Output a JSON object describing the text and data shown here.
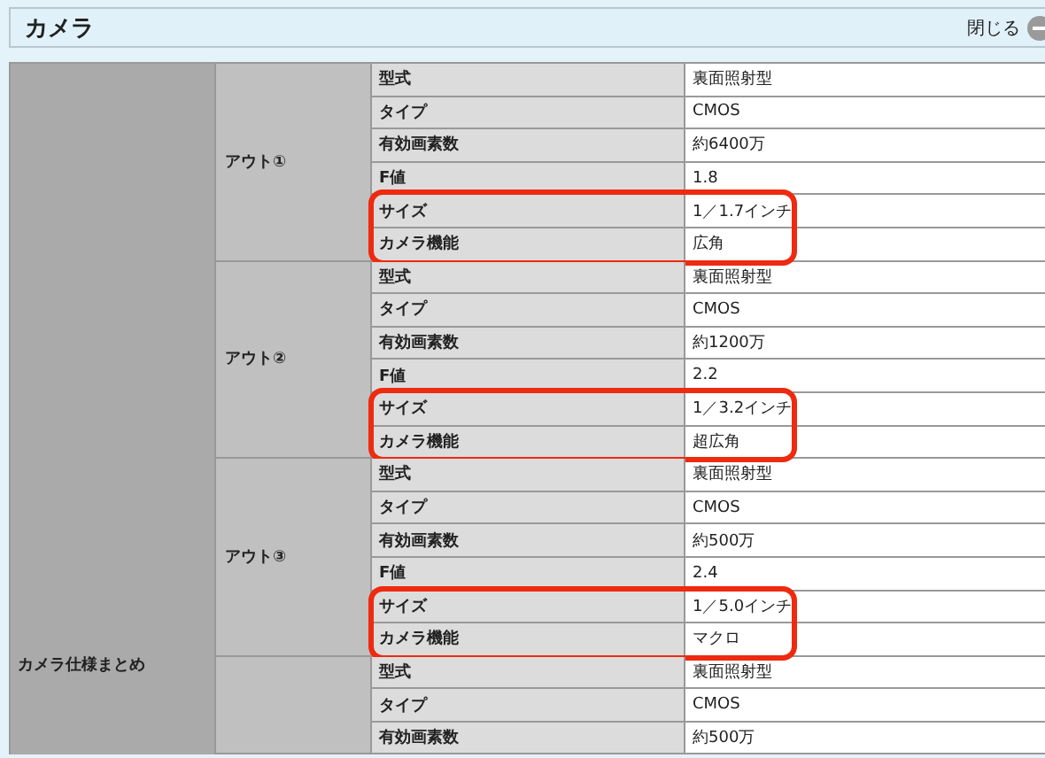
{
  "panel": {
    "title": "カメラ",
    "close_label": "閉じる"
  },
  "summary_label": "カメラ仕様まとめ",
  "groups": [
    {
      "label": "アウト①",
      "rows": [
        {
          "name": "型式",
          "value": "裏面照射型",
          "highlighted": false
        },
        {
          "name": "タイプ",
          "value": "CMOS",
          "highlighted": false
        },
        {
          "name": "有効画素数",
          "value": "約6400万",
          "highlighted": false
        },
        {
          "name": "F値",
          "value": "1.8",
          "highlighted": false
        },
        {
          "name": "サイズ",
          "value": "1／1.7インチ",
          "highlighted": true
        },
        {
          "name": "カメラ機能",
          "value": "広角",
          "highlighted": true
        }
      ]
    },
    {
      "label": "アウト②",
      "rows": [
        {
          "name": "型式",
          "value": "裏面照射型",
          "highlighted": false
        },
        {
          "name": "タイプ",
          "value": "CMOS",
          "highlighted": false
        },
        {
          "name": "有効画素数",
          "value": "約1200万",
          "highlighted": false
        },
        {
          "name": "F値",
          "value": "2.2",
          "highlighted": false
        },
        {
          "name": "サイズ",
          "value": "1／3.2インチ",
          "highlighted": true
        },
        {
          "name": "カメラ機能",
          "value": "超広角",
          "highlighted": true
        }
      ]
    },
    {
      "label": "アウト③",
      "rows": [
        {
          "name": "型式",
          "value": "裏面照射型",
          "highlighted": false
        },
        {
          "name": "タイプ",
          "value": "CMOS",
          "highlighted": false
        },
        {
          "name": "有効画素数",
          "value": "約500万",
          "highlighted": false
        },
        {
          "name": "F値",
          "value": "2.4",
          "highlighted": false
        },
        {
          "name": "サイズ",
          "value": "1／5.0インチ",
          "highlighted": true
        },
        {
          "name": "カメラ機能",
          "value": "マクロ",
          "highlighted": true
        }
      ]
    },
    {
      "rows": [
        {
          "name": "型式",
          "value": "裏面照射型",
          "highlighted": false
        },
        {
          "name": "タイプ",
          "value": "CMOS",
          "highlighted": false
        },
        {
          "name": "有効画素数",
          "value": "約500万",
          "highlighted": false
        }
      ]
    }
  ]
}
